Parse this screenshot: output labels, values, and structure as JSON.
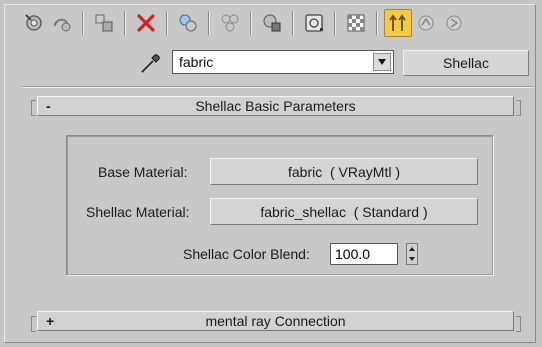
{
  "toolbar": {
    "buttons": [
      {
        "icon": "get-material-icon"
      },
      {
        "icon": "put-to-scene-icon"
      },
      {
        "icon": "assign-to-selection-icon"
      },
      {
        "icon": "delete-icon",
        "color": "#d42020"
      },
      {
        "icon": "make-copy-icon"
      },
      {
        "icon": "make-unique-icon"
      },
      {
        "icon": "put-to-library-icon"
      },
      {
        "icon": "material-id-channel-icon"
      },
      {
        "icon": "show-in-viewport-icon"
      },
      {
        "icon": "show-end-result-icon",
        "active": true,
        "color": "#f2c94a"
      },
      {
        "icon": "go-to-parent-icon"
      },
      {
        "icon": "go-forward-to-sibling-icon"
      }
    ]
  },
  "material": {
    "name": "fabric",
    "type_label": "Shellac"
  },
  "rollouts": {
    "basic": {
      "toggle": "-",
      "title": "Shellac Basic Parameters",
      "base_label": "Base Material:",
      "base_value": "fabric  ( VRayMtl )",
      "shellac_label": "Shellac Material:",
      "shellac_value": "fabric_shellac  ( Standard )",
      "blend_label": "Shellac Color Blend:",
      "blend_value": "100.0"
    },
    "mentalray": {
      "toggle": "+",
      "title": "mental ray Connection"
    }
  }
}
